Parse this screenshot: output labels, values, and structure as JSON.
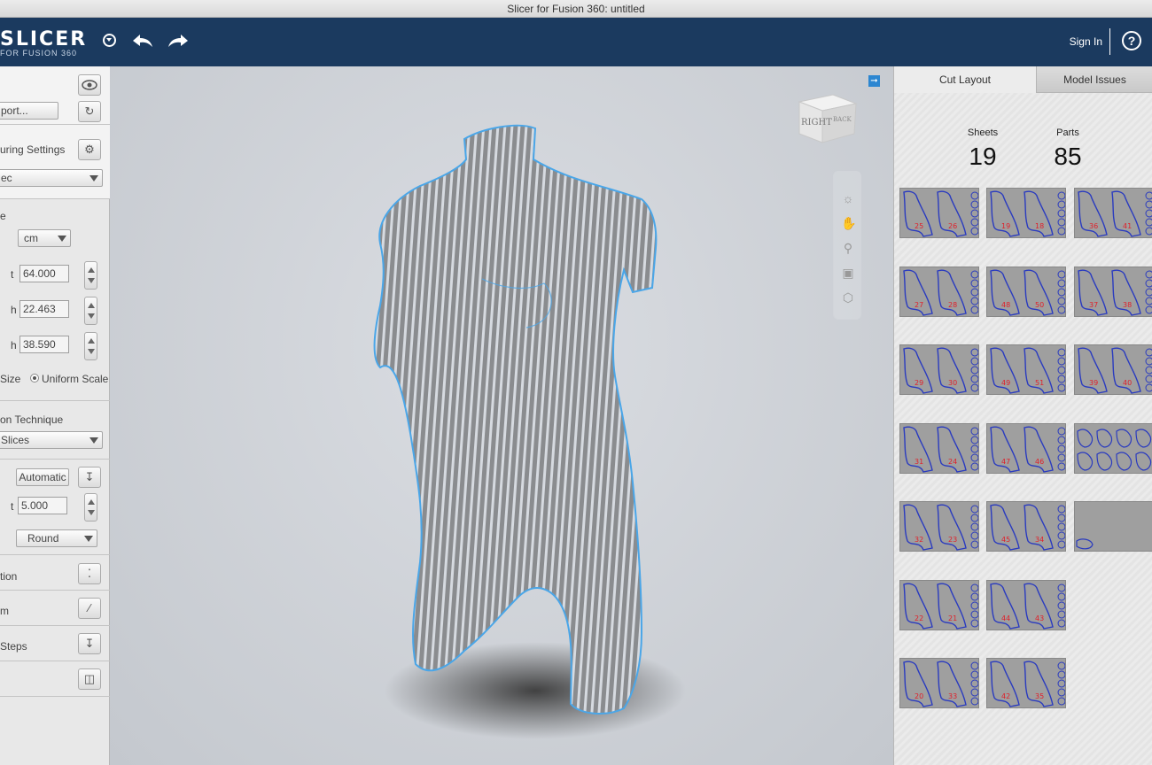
{
  "window": {
    "title": "Slicer for Fusion 360: untitled"
  },
  "header": {
    "logo_main": "SLICER",
    "logo_sub": "FOR FUSION 360",
    "sign_in": "Sign In",
    "help": "?"
  },
  "left_panel": {
    "import_label": "port...",
    "manufacturing_label": "uring Settings",
    "manufacturing_select": "ec",
    "size_label": "e",
    "units": "cm",
    "height_label": "t",
    "height_value": "64.000",
    "width_label": "h",
    "width_value": "22.463",
    "length_label": "h",
    "length_value": "38.590",
    "size_option": "Size",
    "uniform_scale": "Uniform Scale",
    "technique_label": "on Technique",
    "technique_select": "Slices",
    "mode_select": "Automatic",
    "offset_label": "t",
    "offset_value": "5.000",
    "shape_select": "Round",
    "item_slice_direction": "tion",
    "item_form": "m",
    "item_assembly": "Steps"
  },
  "viewport": {
    "viewcube_right": "RIGHT",
    "viewcube_back": "BACK"
  },
  "right_panel": {
    "tabs": [
      "Cut Layout",
      "Model Issues"
    ],
    "sheets_label": "Sheets",
    "sheets_value": "19",
    "parts_label": "Parts",
    "parts_value": "85",
    "sheets": [
      {
        "labels": [
          "25",
          "26"
        ]
      },
      {
        "labels": [
          "19",
          "18"
        ]
      },
      {
        "labels": [
          "36",
          "41"
        ]
      },
      {
        "labels": [
          "27",
          "28"
        ]
      },
      {
        "labels": [
          "48",
          "50"
        ]
      },
      {
        "labels": [
          "37",
          "38"
        ]
      },
      {
        "labels": [
          "29",
          "30"
        ]
      },
      {
        "labels": [
          "49",
          "51"
        ]
      },
      {
        "labels": [
          "39",
          "40"
        ]
      },
      {
        "labels": [
          "31",
          "24"
        ]
      },
      {
        "labels": [
          "47",
          "46"
        ]
      },
      {
        "labels": []
      },
      {
        "labels": [
          "32",
          "23"
        ]
      },
      {
        "labels": [
          "45",
          "34"
        ]
      },
      {
        "labels": []
      },
      {
        "labels": [
          "22",
          "21"
        ]
      },
      {
        "labels": [
          "44",
          "43"
        ]
      },
      {
        "labels": [
          "20",
          "33"
        ]
      },
      {
        "labels": [
          "42",
          "35"
        ]
      }
    ]
  },
  "colors": {
    "header": "#1b3a5f",
    "slice_blue": "#4aa6e8",
    "part_outline": "#2a3bbf",
    "part_label": "#e0202a"
  }
}
